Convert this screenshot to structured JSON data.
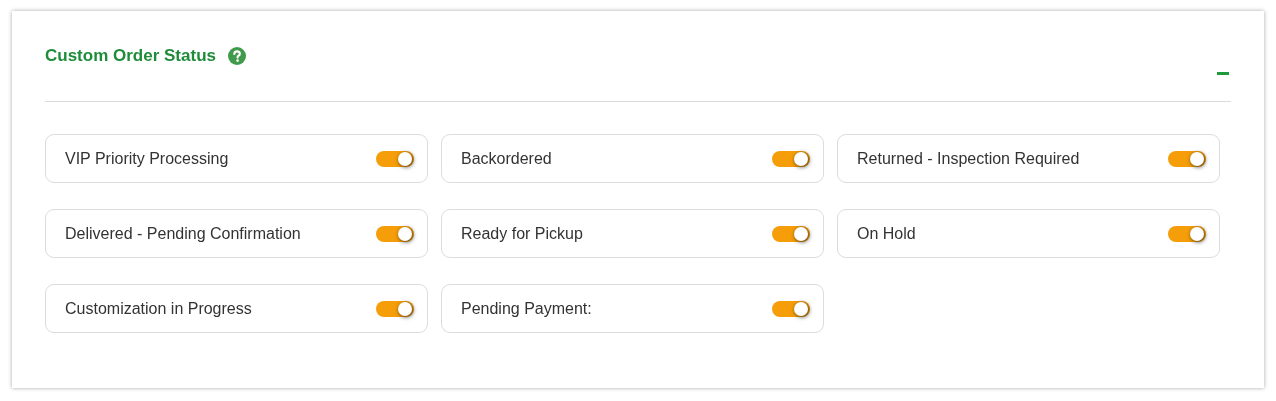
{
  "panel": {
    "title": "Custom Order Status",
    "expanded": true
  },
  "statuses": [
    {
      "label": "VIP Priority Processing",
      "on": true
    },
    {
      "label": "Backordered",
      "on": true
    },
    {
      "label": "Returned - Inspection Required",
      "on": true
    },
    {
      "label": "Delivered - Pending Confirmation",
      "on": true
    },
    {
      "label": "Ready for Pickup",
      "on": true
    },
    {
      "label": "On Hold",
      "on": true
    },
    {
      "label": "Customization in Progress",
      "on": true
    },
    {
      "label": "Pending Payment:",
      "on": true
    }
  ]
}
